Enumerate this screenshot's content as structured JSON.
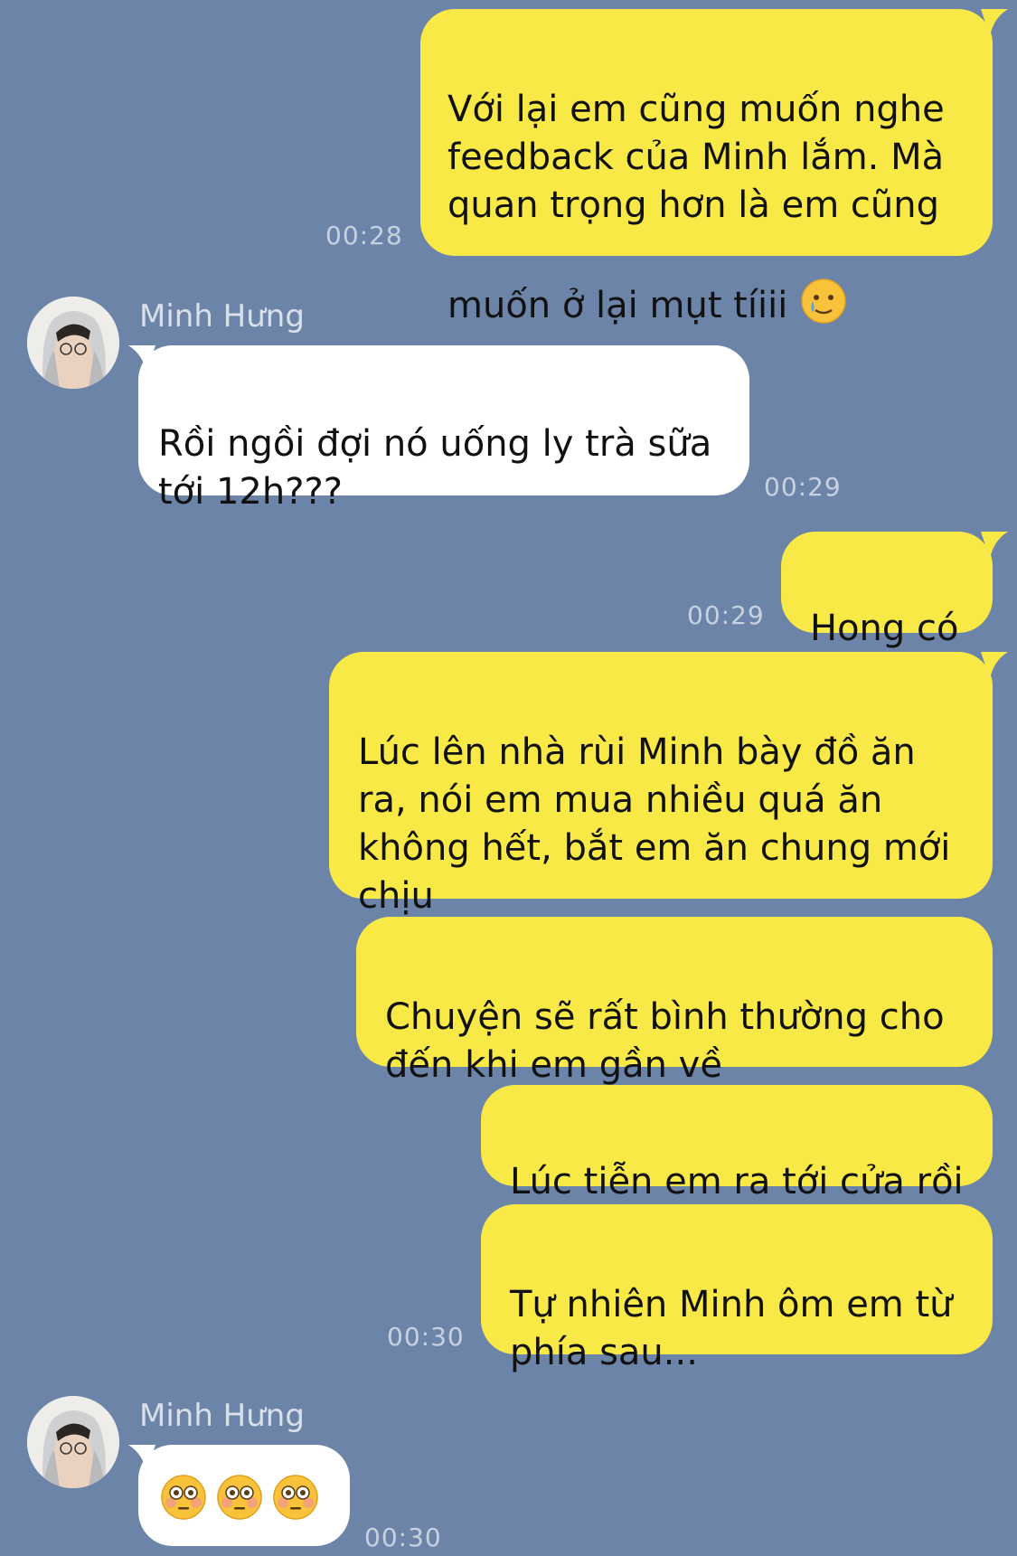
{
  "colors": {
    "background": "#6c84a8",
    "outgoing_bubble": "#f9e947",
    "incoming_bubble": "#ffffff",
    "timestamp": "#c7d1df"
  },
  "messages": [
    {
      "id": "m1",
      "side": "out",
      "text": "Với lại em cũng muốn nghe\nfeedback của Minh lắm. Mà\nquan trọng hơn là em cũng\nmuốn ở lại mụt tíiii",
      "emoji": "crying-smile-emoji",
      "time": "00:28"
    },
    {
      "id": "m2",
      "side": "in",
      "sender": "Minh Hưng",
      "text": "Rồi ngồi đợi nó uống ly trà sữa\ntới 12h???",
      "time": "00:29"
    },
    {
      "id": "m3",
      "side": "out",
      "text": "Hong có",
      "time": "00:29"
    },
    {
      "id": "m4",
      "side": "out",
      "text": "Lúc lên nhà rùi Minh bày đồ ăn\nra, nói em mua nhiều quá ăn\nkhông hết, bắt em ăn chung mới\nchịu",
      "time": ""
    },
    {
      "id": "m5",
      "side": "out",
      "text": "Chuyện sẽ rất bình thường cho\nđến khi em gần về",
      "time": ""
    },
    {
      "id": "m6",
      "side": "out",
      "text": "Lúc tiễn em ra tới cửa rồi",
      "time": ""
    },
    {
      "id": "m7",
      "side": "out",
      "text": "Tự nhiên Minh ôm em từ\nphía sau...",
      "time": "00:30"
    },
    {
      "id": "m8",
      "side": "in",
      "sender": "Minh Hưng",
      "emojis": [
        "flushed-face-emoji",
        "flushed-face-emoji",
        "flushed-face-emoji"
      ],
      "time": "00:30"
    }
  ]
}
